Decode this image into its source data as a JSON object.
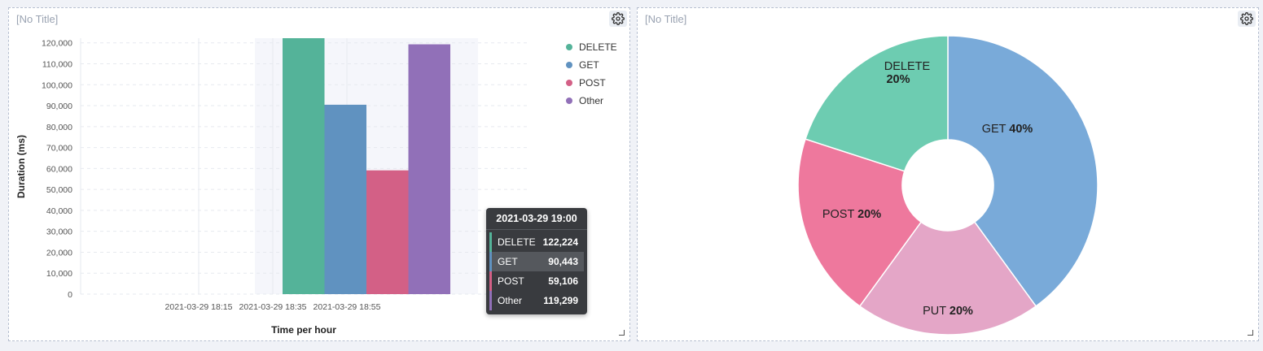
{
  "left_panel": {
    "title": "[No Title]",
    "icons": [
      "gear-icon",
      "resize-handle-icon"
    ]
  },
  "right_panel": {
    "title": "[No Title]",
    "icons": [
      "gear-icon",
      "resize-handle-icon"
    ]
  },
  "colors": {
    "DELETE": "#54b399",
    "GET": "#6092c0",
    "POST": "#d36086",
    "Other": "#9170b8",
    "pie_DELETE": "#6dccb1",
    "pie_GET": "#79aad9",
    "pie_POST": "#ee789d",
    "pie_PUT": "#e4a6c7"
  },
  "tooltip": {
    "header": "2021-03-29 19:00",
    "rows": [
      {
        "label": "DELETE",
        "value": "122,224"
      },
      {
        "label": "GET",
        "value": "90,443"
      },
      {
        "label": "POST",
        "value": "59,106"
      },
      {
        "label": "Other",
        "value": "119,299"
      }
    ]
  },
  "chart_data": [
    {
      "type": "bar",
      "xlabel": "Time per hour",
      "ylabel": "Duration (ms)",
      "ylim": [
        0,
        122224
      ],
      "yticks": [
        0,
        10000,
        20000,
        30000,
        40000,
        50000,
        60000,
        70000,
        80000,
        90000,
        100000,
        110000,
        120000
      ],
      "ytick_labels": [
        "0",
        "10,000",
        "20,000",
        "30,000",
        "40,000",
        "50,000",
        "60,000",
        "70,000",
        "80,000",
        "90,000",
        "100,000",
        "110,000",
        "120,000"
      ],
      "xtick_labels": [
        "2021-03-29 18:15",
        "2021-03-29 18:35",
        "2021-03-29 18:55"
      ],
      "categories": [
        "2021-03-29 19:00"
      ],
      "series": [
        {
          "name": "DELETE",
          "values": [
            122224
          ]
        },
        {
          "name": "GET",
          "values": [
            90443
          ]
        },
        {
          "name": "POST",
          "values": [
            59106
          ]
        },
        {
          "name": "Other",
          "values": [
            119299
          ]
        }
      ],
      "legend": "top-right",
      "grid": true
    },
    {
      "type": "pie",
      "donut": true,
      "slices": [
        {
          "label": "GET",
          "pct_label": "40%",
          "value": 40
        },
        {
          "label": "PUT",
          "pct_label": "20%",
          "value": 20
        },
        {
          "label": "POST",
          "pct_label": "20%",
          "value": 20
        },
        {
          "label": "DELETE",
          "pct_label": "20%",
          "value": 20
        }
      ]
    }
  ]
}
